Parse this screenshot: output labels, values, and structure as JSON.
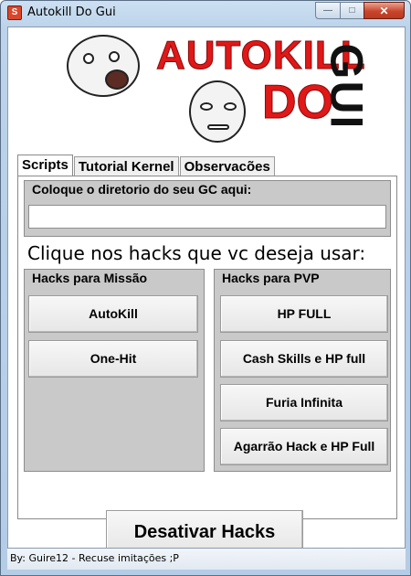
{
  "window": {
    "title": "Autokill Do Gui",
    "app_icon": "app-icon",
    "controls": {
      "minimize": "—",
      "maximize": "□",
      "close": "✕"
    }
  },
  "banner": {
    "line1": "AUTOKILL",
    "line2": "DO",
    "line3": "GUI",
    "colors": {
      "logo_red": "#e01818",
      "logo_black": "#111111"
    }
  },
  "tabs": [
    {
      "label": "Scripts",
      "active": true
    },
    {
      "label": "Tutorial Kernel",
      "active": false
    },
    {
      "label": "Observacões",
      "active": false
    }
  ],
  "directory": {
    "label": "Coloque o diretorio do seu GC aqui:",
    "value": ""
  },
  "hint": "Clique nos hacks que vc deseja usar:",
  "mission": {
    "label": "Hacks para Missão",
    "buttons": [
      "AutoKill",
      "One-Hit"
    ]
  },
  "pvp": {
    "label": "Hacks para PVP",
    "buttons": [
      "HP FULL",
      "Cash Skills e HP full",
      "Furia Infinita",
      "Agarrão Hack e HP Full"
    ]
  },
  "deactivate_label": "Desativar Hacks",
  "status": "By: Guire12 - Recuse imitações ;P"
}
